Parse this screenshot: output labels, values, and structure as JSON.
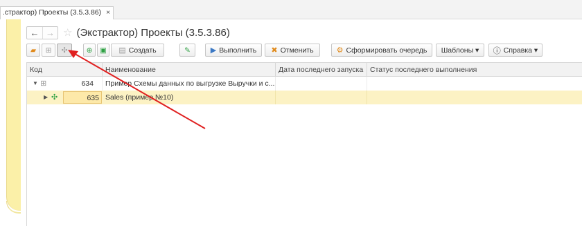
{
  "tab": {
    "label": ".страктор) Проекты (3.5.3.86)",
    "close": "×"
  },
  "header": {
    "back": "←",
    "forward": "→",
    "star": "☆",
    "title": "(Экстрактор) Проекты (3.5.3.86)"
  },
  "toolbar": {
    "create_label": "Создать",
    "run_label": "Выполнить",
    "cancel_label": "Отменить",
    "queue_label": "Сформировать очередь",
    "templates_label": "Шаблоны ▾",
    "help_label": "Справка ▾"
  },
  "icons": {
    "folder_open": "folder-open-icon",
    "hierarchy": "hierarchy-icon",
    "tree": "tree-structure-icon",
    "add": "add-icon",
    "copy": "copy-icon",
    "create": "create-icon",
    "edit": "pencil-icon",
    "run": "run-icon",
    "cancel": "cancel-icon",
    "queue": "queue-icon",
    "help": "info-icon"
  },
  "table": {
    "columns": [
      "Код",
      "Наименование",
      "Дата последнего запуска",
      "Статус последнего выполнения"
    ],
    "rows": [
      {
        "code": "634",
        "name": "Пример Схемы данных по выгрузке Выручки и с...",
        "last_run": "",
        "status": "",
        "expanded": true,
        "selected": false
      },
      {
        "code": "635",
        "name": "Sales (пример №10)",
        "last_run": "",
        "status": "",
        "expanded": false,
        "selected": true
      }
    ]
  },
  "colors": {
    "accent_yellow": "#fbf0a8",
    "selection": "#fcf2c4",
    "annotation_arrow": "#e02020"
  }
}
